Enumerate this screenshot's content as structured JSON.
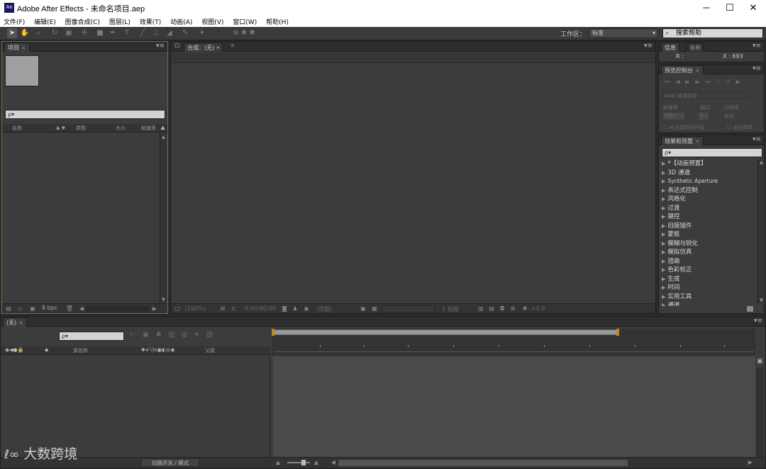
{
  "app": {
    "logo_text": "Ae",
    "window_title": "Adobe After Effects - 未命名项目.aep",
    "window_controls": [
      "minimize-icon",
      "maximize-icon",
      "close-icon"
    ]
  },
  "menu": {
    "items": [
      "文件(F)",
      "编辑(E)",
      "图像合成(C)",
      "图层(L)",
      "效果(T)",
      "动画(A)",
      "视图(V)",
      "窗口(W)",
      "帮助(H)"
    ]
  },
  "toolbar": {
    "tools": [
      "selection-tool-icon",
      "hand-tool-icon",
      "zoom-tool-icon",
      "rotate-tool-icon",
      "camera-tool-icon",
      "pan-behind-tool-icon",
      "mask-tool-icon",
      "pen-tool-icon",
      "type-tool-icon",
      "brush-tool-icon",
      "clone-stamp-tool-icon",
      "eraser-tool-icon",
      "roto-brush-tool-icon",
      "puppet-tool-icon"
    ],
    "workspace_label": "工作区：",
    "workspace_value": "标准",
    "help_search_text": "搜索帮助"
  },
  "project_panel": {
    "tab_label": "项目",
    "columns": {
      "name": "名称",
      "type": "类型",
      "size": "大小",
      "fps": "帧速率"
    },
    "bpc_label": "8 bpc",
    "search_placeholder": "ρ▾"
  },
  "comp_panel": {
    "tab_label": "合成：(无)",
    "zoom": "(100%)",
    "timecode": "0:00:00:00",
    "resolution": "(完整)",
    "view": "1 视图",
    "exposure": "+0.0"
  },
  "info_panel": {
    "tabs": [
      "信息",
      "音频"
    ],
    "r_label": "R :",
    "x_label": "X : 693"
  },
  "preview_panel": {
    "tab_label": "预览控制台",
    "ram_label": "RAM 预演选项",
    "frame_rate_label": "帧速率",
    "skip_label": "跳过",
    "resolution_label": "分辨率",
    "frame_rate_value": "(30)",
    "skip_value": "0",
    "resolution_value": "自动",
    "from_current_label": "从当前时间开始",
    "full_screen_label": "全分辨率"
  },
  "effects_panel": {
    "tab_label": "效果和预置",
    "search_placeholder": "ρ▾",
    "items": [
      "*【动画预置】",
      "3D 通道",
      "Synthetic Aperture",
      "表达式控制",
      "风格化",
      "过渡",
      "键控",
      "旧版插件",
      "蒙板",
      "模糊与锐化",
      "模拟仿真",
      "扭曲",
      "色彩校正",
      "生成",
      "时间",
      "实用工具",
      "通道"
    ]
  },
  "timeline": {
    "tab_label": "(无)",
    "search_placeholder": "ρ▾",
    "source_name_label": "源名称",
    "parent_label": "父级",
    "toggle_label": "切换开关 / 模式"
  },
  "watermark": {
    "text": "大数跨境"
  }
}
